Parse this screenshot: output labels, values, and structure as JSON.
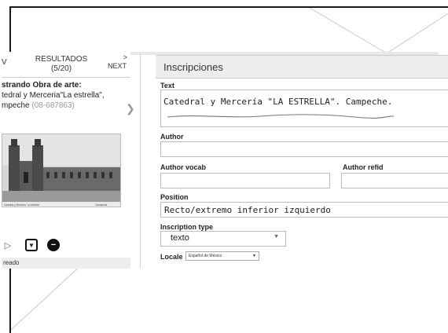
{
  "nav": {
    "prev_label": "V",
    "results_label": "RESULTADOS",
    "results_count": "(5/20)",
    "next_arrow": ">",
    "next_label": "NEXT"
  },
  "record": {
    "showing_label": "strando Obra de arte:",
    "title_line1": "tedral y Merceria\"La estrella\",",
    "title_line2": "mpeche",
    "object_id": "(08-687863)"
  },
  "thumbnail": {
    "caption_left": "Catedral y Merceria \"La estrella\"",
    "caption_right": "Campeche"
  },
  "status": {
    "text": "reado"
  },
  "icons": [
    "play-icon",
    "download-icon",
    "remove-icon",
    "chevron-right-icon"
  ],
  "section": {
    "title": "Inscripciones"
  },
  "fields": {
    "text_label": "Text",
    "text_value": "Catedral y Mercería \"LA ESTRELLA\". Campeche.",
    "author_label": "Author",
    "author_value": "",
    "author_vocab_label": "Author vocab",
    "author_vocab_value": "",
    "author_refid_label": "Author refid",
    "author_refid_value": "",
    "position_label": "Position",
    "position_value": "Recto/extremo inferior izquierdo",
    "inscription_type_label": "Inscription type",
    "inscription_type_value": "texto",
    "locale_label": "Locale",
    "locale_value": "Español de México"
  }
}
